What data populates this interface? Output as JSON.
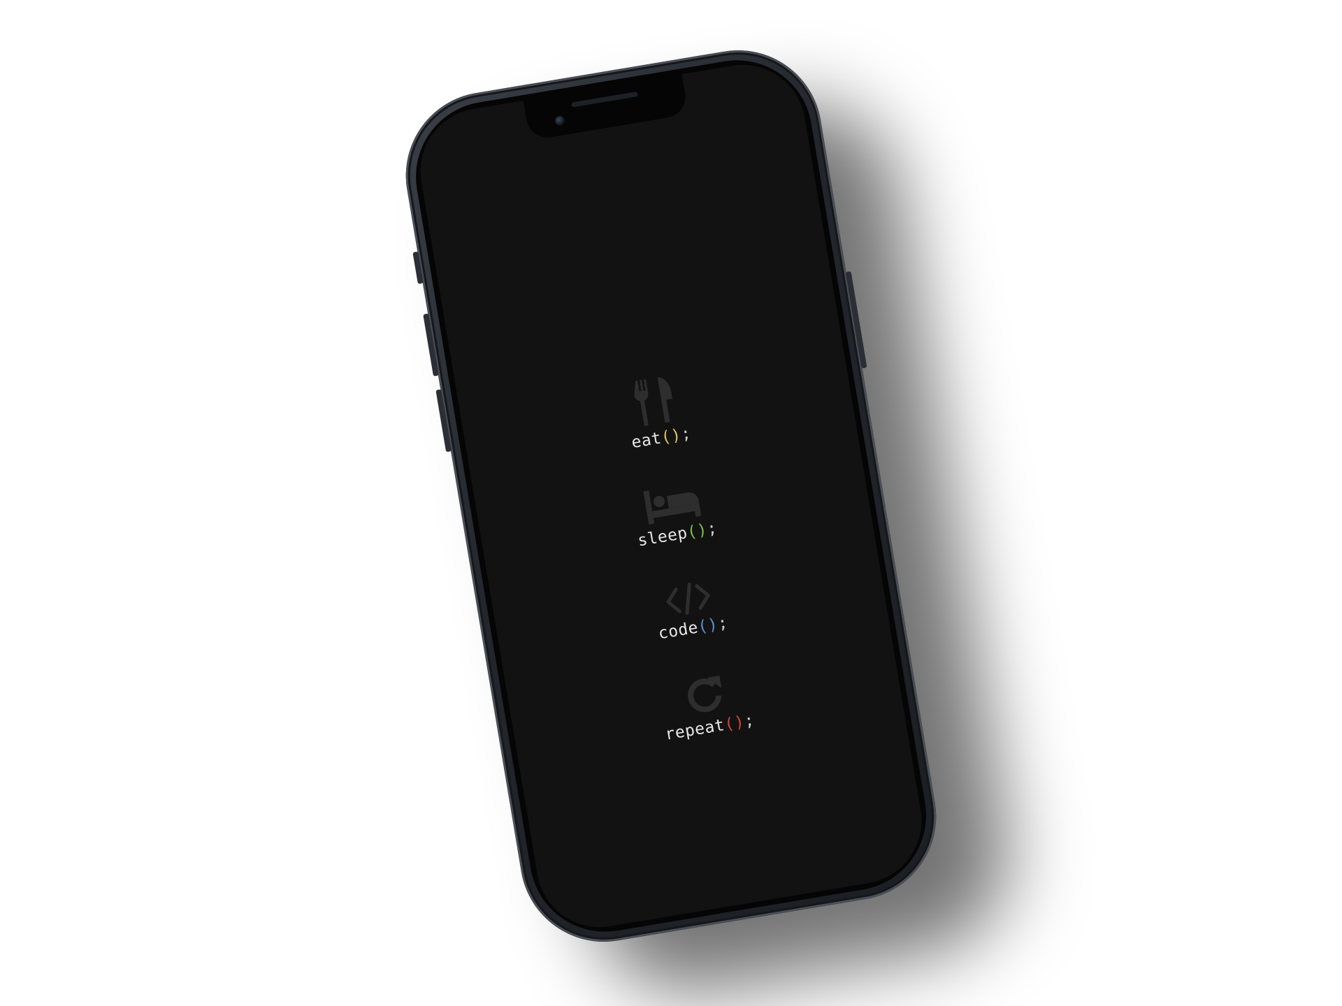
{
  "wallpaper": {
    "items": [
      {
        "icon": "fork-knife-icon",
        "name": "eat",
        "parens": "()",
        "semicolon": ";",
        "paren_color": "#e2c35a"
      },
      {
        "icon": "bed-icon",
        "name": "sleep",
        "parens": "()",
        "semicolon": ";",
        "paren_color": "#7dbb4a"
      },
      {
        "icon": "code-icon",
        "name": "code",
        "parens": "()",
        "semicolon": ";",
        "paren_color": "#5b8fd6"
      },
      {
        "icon": "refresh-icon",
        "name": "repeat",
        "parens": "()",
        "semicolon": ";",
        "paren_color": "#d0453d"
      }
    ]
  },
  "colors": {
    "screen_background": "#121212",
    "icon_color": "#2e2e2e",
    "label_color": "#e6e6e6",
    "page_background": "#ffffff"
  }
}
